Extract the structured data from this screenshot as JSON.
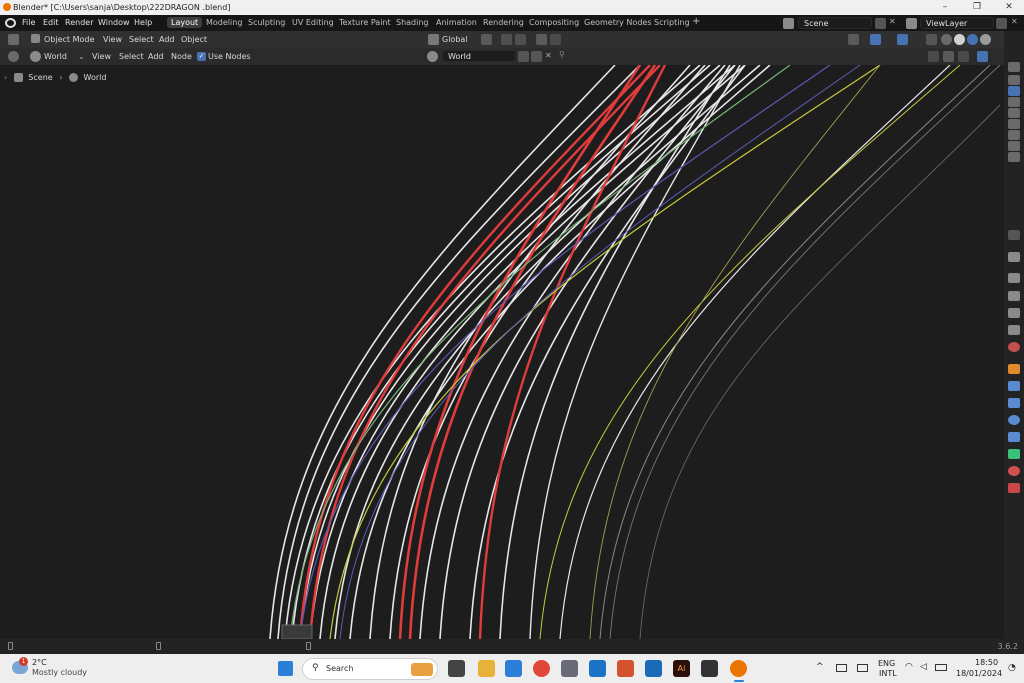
{
  "window": {
    "title": "Blender* [C:\\Users\\sanja\\Desktop\\222DRAGON .blend]",
    "controls": [
      "–",
      "❐",
      "✕"
    ]
  },
  "menu": [
    "File",
    "Edit",
    "Render",
    "Window",
    "Help"
  ],
  "workspaces": [
    "Layout",
    "Modeling",
    "Sculpting",
    "UV Editing",
    "Texture Paint",
    "Shading",
    "Animation",
    "Rendering",
    "Compositing",
    "Geometry Nodes",
    "Scripting",
    "+"
  ],
  "active_workspace": "Layout",
  "scene": {
    "name": "Scene",
    "view_layer": "ViewLayer"
  },
  "header1": {
    "mode": "Object Mode",
    "view": "View",
    "select": "Select",
    "add": "Add",
    "object": "Object",
    "orientation": "Global"
  },
  "header2": {
    "world_type": "World",
    "view": "View",
    "select": "Select",
    "add": "Add",
    "node": "Node",
    "use_nodes": "Use Nodes",
    "use_nodes_checked": true,
    "world_name": "World"
  },
  "breadcrumb": {
    "scene": "Scene",
    "world": "World"
  },
  "status": {
    "version": "3.6.2"
  },
  "taskbar": {
    "weather_temp": "2°C",
    "weather_desc": "Mostly cloudy",
    "weather_badge": "1",
    "search_placeholder": "Search",
    "lang": "ENG",
    "layout": "INTL",
    "time": "18:50",
    "date": "18/01/2024"
  },
  "colors": {
    "accent": "#4772b3",
    "wire_white": "#e6e6e6",
    "wire_red": "#e03c3c",
    "wire_yellow": "#c8c83c",
    "wire_blue": "#5a5ab4",
    "wire_green": "#7ab47a",
    "blender_orange": "#ea7600"
  }
}
